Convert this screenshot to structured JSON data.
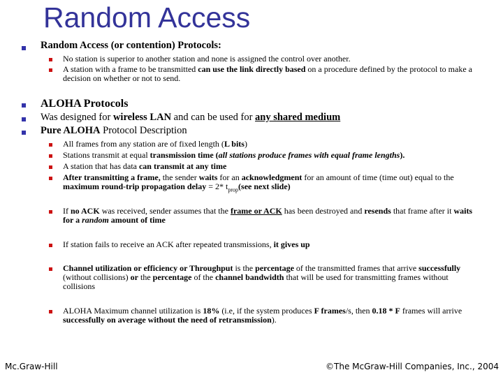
{
  "slide": {
    "title": "Random Access",
    "colors": {
      "title": "#333399",
      "bullet_level1": "#3333aa",
      "bullet_level2": "#cc1111"
    },
    "section1": {
      "heading": "Random Access (or contention) Protocols:",
      "items": [
        {
          "text": "No station is superior to another station and none is assigned the control over another."
        },
        {
          "pre": "A station with a frame to be transmitted ",
          "bold": "can use the link directly based",
          "post": " on a procedure defined by the protocol to make a decision on whether or not to send."
        }
      ]
    },
    "aloha_heading": "ALOHA Protocols",
    "wireless": {
      "pre": "Was designed for ",
      "bold": "wireless LAN",
      "mid": " and can be used for ",
      "underline": "any shared medium"
    },
    "pure": {
      "bold": "Pure ALOHA",
      "post": " Protocol Description"
    },
    "items": {
      "i1": {
        "pre": "All frames from any station are of fixed length (",
        "bold": "L bits",
        "post": ")"
      },
      "i2": {
        "pre": "Stations transmit at equal ",
        "bold": "transmission time",
        "open": " (",
        "italic": "all stations produce frames with equal frame lengths",
        "post": ")."
      },
      "i3": {
        "pre": "A station that has data ",
        "bold": "can transmit at any time"
      },
      "i4": {
        "bold1": "After transmitting a frame,",
        "t1": " the sender ",
        "bold2": "waits",
        "t2": " for an ",
        "bold3": "acknowledgment",
        "t3": " for an amount of time (time out) equal to the ",
        "bold4": "maximum round-trip propagation delay",
        "t4": " = 2* t",
        "sub": "prop",
        "bold5": "(see next slide)"
      },
      "i5": {
        "t1": "If ",
        "bold1": "no ACK",
        "t2": " was received, sender assumes that the ",
        "ub": "frame or ACK",
        "t3": " has been destroyed  and ",
        "bold2": "resends",
        "t4": " that frame after it ",
        "bold3": "waits for a ",
        "italic": "random",
        "bold4": " amount of time"
      },
      "i6": {
        "pre": "If station fails to receive an ACK after repeated transmissions, ",
        "bold": "it gives up"
      },
      "i7": {
        "bold1": "Channel utilization or efficiency or Throughput",
        "t1": " is the ",
        "bold2": "percentage",
        "t2": " of the transmitted frames that arrive ",
        "bold3": "successfully",
        "t3": " (without collisions) ",
        "bold4": "or",
        "t4": " the ",
        "bold5": "percentage",
        "t5": " of the ",
        "bold6": "channel bandwidth",
        "t6": " that will be used for transmitting frames without collisions"
      },
      "i8": {
        "t1": "ALOHA Maximum channel utilization is ",
        "bold1": "18%",
        "t2": " (i.e, if the system produces ",
        "bold2": "F frames",
        "t3": "/s, then ",
        "bold3": "0.18 * F",
        "t4": " frames will arrive ",
        "bold4": "successfully on average without the need of retransmission",
        "t5": ")."
      }
    },
    "footer": {
      "left": "Mc.Graw-Hill",
      "right": "©The McGraw-Hill Companies, Inc., 2004"
    }
  }
}
